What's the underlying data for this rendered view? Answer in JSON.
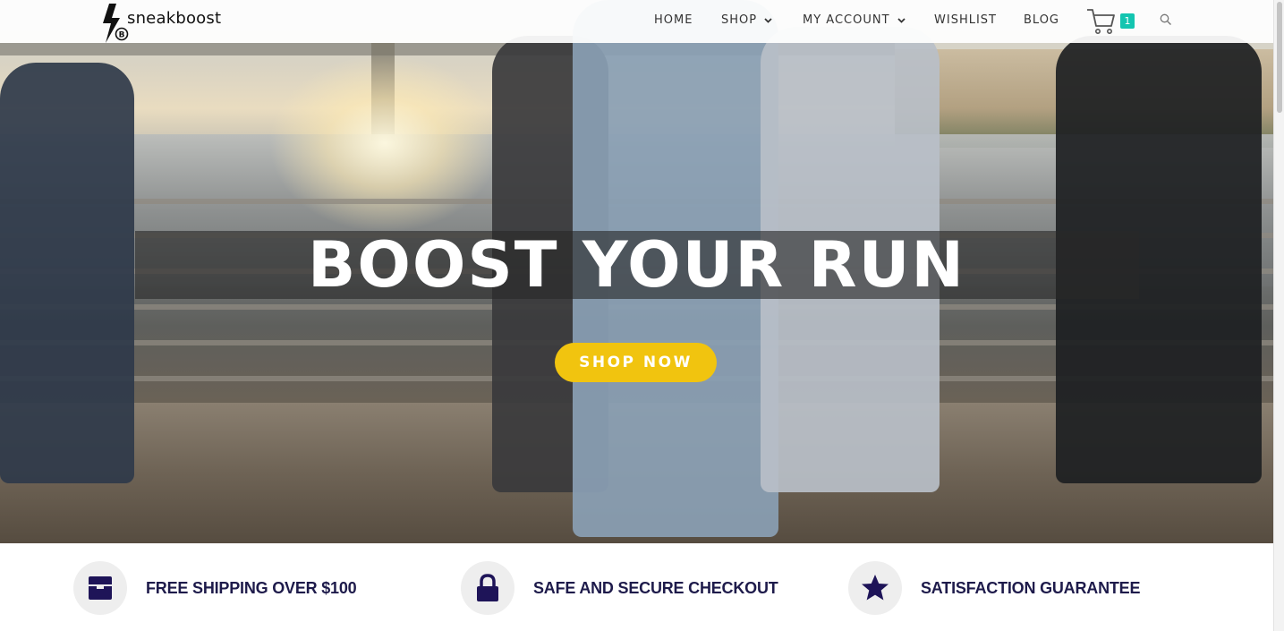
{
  "brand": {
    "name": "sneakboost",
    "mark_letter": "B",
    "logo_icon": "lightning-bolt-icon"
  },
  "nav": {
    "items": [
      {
        "label": "HOME",
        "has_dropdown": false
      },
      {
        "label": "SHOP",
        "has_dropdown": true
      },
      {
        "label": "MY ACCOUNT",
        "has_dropdown": true
      },
      {
        "label": "WISHLIST",
        "has_dropdown": false
      },
      {
        "label": "BLOG",
        "has_dropdown": false
      }
    ],
    "cart_count": "1",
    "cart_icon": "shopping-cart-icon",
    "search_icon": "search-icon"
  },
  "hero": {
    "title": "BOOST YOUR RUN",
    "cta_label": "SHOP NOW"
  },
  "features": [
    {
      "label": "FREE SHIPPING OVER $100",
      "icon": "box-icon"
    },
    {
      "label": "SAFE AND SECURE CHECKOUT",
      "icon": "lock-icon"
    },
    {
      "label": "SATISFACTION GUARANTEE",
      "icon": "star-icon"
    }
  ],
  "colors": {
    "accent_yellow": "#f1c40f",
    "badge_teal": "#13c5b0",
    "feature_text": "#1e1b4b",
    "icon_purple": "#1e1458"
  }
}
